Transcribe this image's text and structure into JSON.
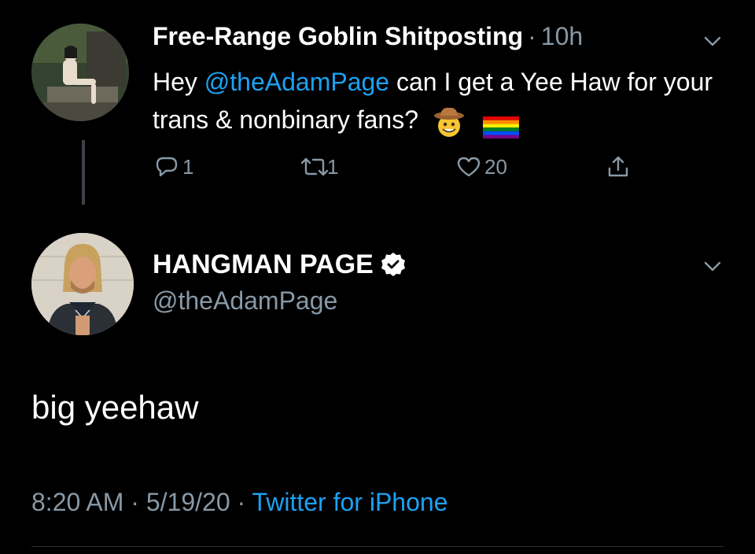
{
  "reply_tweet": {
    "author_name": "Free-Range Goblin Shitposting",
    "separator": "·",
    "time_ago": "10h",
    "text_before": "Hey ",
    "mention": "@theAdamPage",
    "text_after": " can I get a Yee Haw for your trans & nonbinary fans?",
    "emojis": [
      "cowboy-face-icon",
      "rainbow-flag-icon"
    ],
    "actions": {
      "reply_count": "1",
      "retweet_count": "1",
      "like_count": "20"
    }
  },
  "main_tweet": {
    "display_name": "HANGMAN PAGE",
    "handle": "@theAdamPage",
    "text": "big yeehaw",
    "time": "8:20 AM",
    "separator": "·",
    "date": "5/19/20",
    "source": "Twitter for iPhone"
  },
  "colors": {
    "background": "#000000",
    "text": "#ffffff",
    "secondary": "#8899a6",
    "accent": "#1da1f2"
  }
}
